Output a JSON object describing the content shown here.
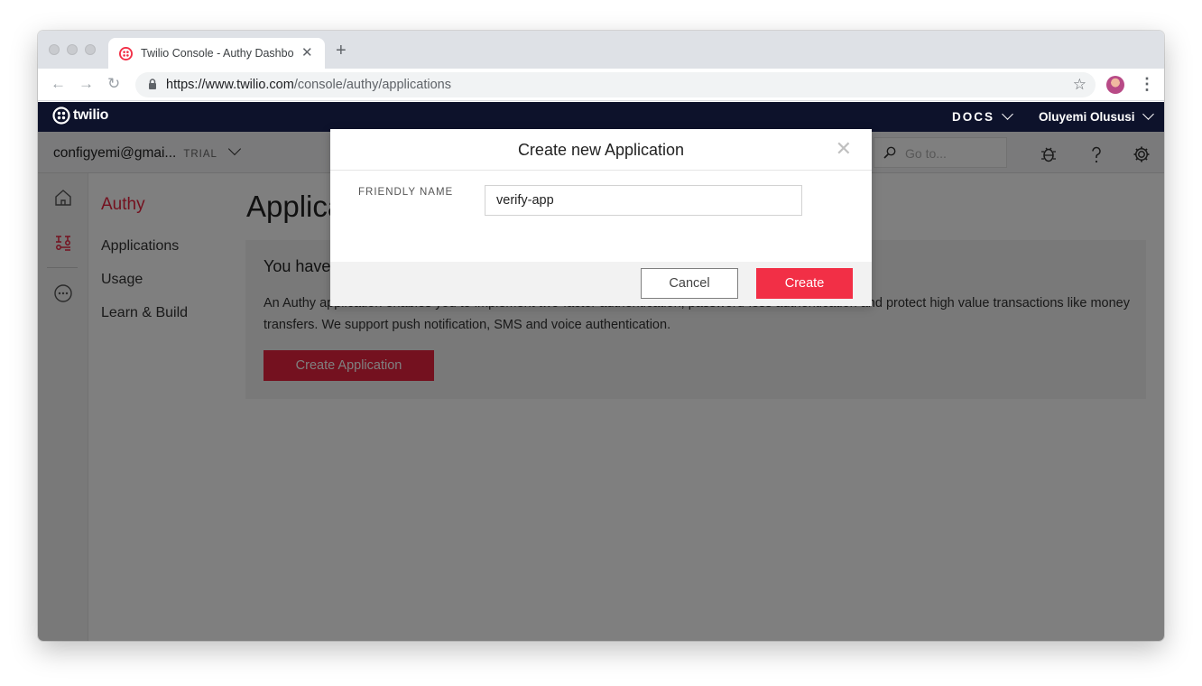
{
  "browser": {
    "tab_title": "Twilio Console - Authy Dashbo",
    "url_host": "https://www.twilio.com",
    "url_path": "/console/authy/applications",
    "colors": {
      "tabstrip": "#dee1e6",
      "favicon": "#f22f46"
    }
  },
  "topbar": {
    "logo_text": "twilio",
    "docs_label": "DOCS",
    "user_name": "Oluyemi Olususi",
    "background": "#0d122b"
  },
  "account": {
    "name": "configyemi@gmai...",
    "badge": "TRIAL",
    "search_placeholder": "Go to..."
  },
  "product_nav": {
    "title": "Authy",
    "items": [
      {
        "label": "Applications"
      },
      {
        "label": "Usage"
      },
      {
        "label": "Learn & Build"
      }
    ]
  },
  "main": {
    "page_title": "Applications",
    "card_title": "You haven't created any Authy applications yet",
    "card_description": "An Authy application enables you to implement two-factor authentication, password-less authentication and protect high value transactions like money transfers. We support push notification, SMS and voice authentication.",
    "card_button": "Create Application"
  },
  "modal": {
    "title": "Create new Application",
    "close_icon": "close-icon",
    "field_label": "FRIENDLY NAME",
    "field_value": "verify-app",
    "cancel_label": "Cancel",
    "create_label": "Create",
    "accent": "#f22f46"
  }
}
